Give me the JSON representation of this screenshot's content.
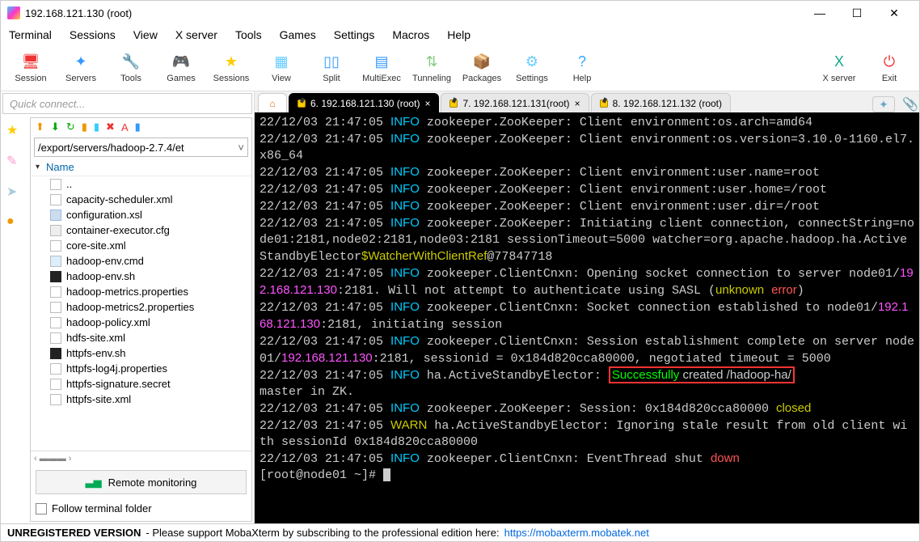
{
  "window": {
    "title": "192.168.121.130 (root)"
  },
  "menu": [
    "Terminal",
    "Sessions",
    "View",
    "X server",
    "Tools",
    "Games",
    "Settings",
    "Macros",
    "Help"
  ],
  "toolbar": [
    {
      "name": "session-button",
      "label": "Session",
      "glyph": "🖥",
      "color": "#e33"
    },
    {
      "name": "servers-button",
      "label": "Servers",
      "glyph": "✦",
      "color": "#39f"
    },
    {
      "name": "tools-button",
      "label": "Tools",
      "glyph": "🔧",
      "color": "#e80"
    },
    {
      "name": "games-button",
      "label": "Games",
      "glyph": "🎮",
      "color": "#9c3"
    },
    {
      "name": "sessions-button",
      "label": "Sessions",
      "glyph": "★",
      "color": "#fc0"
    },
    {
      "name": "view-button",
      "label": "View",
      "glyph": "▦",
      "color": "#6cf"
    },
    {
      "name": "split-button",
      "label": "Split",
      "glyph": "▯▯",
      "color": "#39f"
    },
    {
      "name": "multiexec-button",
      "label": "MultiExec",
      "glyph": "▤",
      "color": "#39f"
    },
    {
      "name": "tunneling-button",
      "label": "Tunneling",
      "glyph": "⇅",
      "color": "#8c8"
    },
    {
      "name": "packages-button",
      "label": "Packages",
      "glyph": "📦",
      "color": "#c96"
    },
    {
      "name": "settings-button",
      "label": "Settings",
      "glyph": "⚙",
      "color": "#6cf"
    },
    {
      "name": "help-button",
      "label": "Help",
      "glyph": "?",
      "color": "#3af"
    }
  ],
  "toolbar_right": [
    {
      "name": "xserver-button",
      "label": "X server",
      "glyph": "X",
      "color": "#1a8"
    },
    {
      "name": "exit-button",
      "label": "Exit",
      "glyph": "⏻",
      "color": "#e33"
    }
  ],
  "quick_connect_placeholder": "Quick connect...",
  "path": "/export/servers/hadoop-2.7.4/et",
  "file_header": "Name",
  "files": [
    {
      "label": "..",
      "icon": "dir"
    },
    {
      "label": "capacity-scheduler.xml",
      "icon": "xml"
    },
    {
      "label": "configuration.xsl",
      "icon": "xsl"
    },
    {
      "label": "container-executor.cfg",
      "icon": "cfg"
    },
    {
      "label": "core-site.xml",
      "icon": "xml"
    },
    {
      "label": "hadoop-env.cmd",
      "icon": "cmd"
    },
    {
      "label": "hadoop-env.sh",
      "icon": "sh"
    },
    {
      "label": "hadoop-metrics.properties",
      "icon": "xml"
    },
    {
      "label": "hadoop-metrics2.properties",
      "icon": "xml"
    },
    {
      "label": "hadoop-policy.xml",
      "icon": "xml"
    },
    {
      "label": "hdfs-site.xml",
      "icon": "xml"
    },
    {
      "label": "httpfs-env.sh",
      "icon": "sh"
    },
    {
      "label": "httpfs-log4j.properties",
      "icon": "xml"
    },
    {
      "label": "httpfs-signature.secret",
      "icon": "xml"
    },
    {
      "label": "httpfs-site.xml",
      "icon": "xml"
    }
  ],
  "remote_monitoring": "Remote monitoring",
  "follow_terminal": "Follow terminal folder",
  "tabs": [
    {
      "name": "tab-6",
      "label": "6. 192.168.121.130 (root)",
      "active": true,
      "close": true
    },
    {
      "name": "tab-7",
      "label": "7. 192.168.121.131(root)",
      "active": false,
      "close": true
    },
    {
      "name": "tab-8",
      "label": "8. 192.168.121.132 (root)",
      "active": false,
      "close": false
    }
  ],
  "terminal": {
    "lines": [
      [
        [
          "",
          "22/12/03 21:47:05 "
        ],
        [
          "info",
          "INFO"
        ],
        [
          "",
          " zookeeper.ZooKeeper: Client environment:os.arch=amd64"
        ]
      ],
      [
        [
          "",
          "22/12/03 21:47:05 "
        ],
        [
          "info",
          "INFO"
        ],
        [
          "",
          " zookeeper.ZooKeeper: Client environment:os.version=3.10.0-1160.el7.x86_64"
        ]
      ],
      [
        [
          "",
          "22/12/03 21:47:05 "
        ],
        [
          "info",
          "INFO"
        ],
        [
          "",
          " zookeeper.ZooKeeper: Client environment:user.name=root"
        ]
      ],
      [
        [
          "",
          "22/12/03 21:47:05 "
        ],
        [
          "info",
          "INFO"
        ],
        [
          "",
          " zookeeper.ZooKeeper: Client environment:user.home=/root"
        ]
      ],
      [
        [
          "",
          "22/12/03 21:47:05 "
        ],
        [
          "info",
          "INFO"
        ],
        [
          "",
          " zookeeper.ZooKeeper: Client environment:user.dir=/root"
        ]
      ],
      [
        [
          "",
          "22/12/03 21:47:05 "
        ],
        [
          "info",
          "INFO"
        ],
        [
          "",
          " zookeeper.ZooKeeper: Initiating client connection, connectString=node01:2181,node02:2181,node03:2181 sessionTimeout=5000 watcher=org.apache.hadoop.ha.ActiveStandbyElector"
        ],
        [
          "yel",
          "$WatcherWithClientRef"
        ],
        [
          "",
          "@77847718"
        ]
      ],
      [
        [
          "",
          "22/12/03 21:47:05 "
        ],
        [
          "info",
          "INFO"
        ],
        [
          "",
          " zookeeper.ClientCnxn: Opening socket connection to server node01/"
        ],
        [
          "mag",
          "192.168.121.130"
        ],
        [
          "",
          ":2181. Will not attempt to authenticate using SASL ("
        ],
        [
          "yel",
          "unknown"
        ],
        [
          "",
          " "
        ],
        [
          "red",
          "error"
        ],
        [
          "",
          ")"
        ]
      ],
      [
        [
          "",
          "22/12/03 21:47:05 "
        ],
        [
          "info",
          "INFO"
        ],
        [
          "",
          " zookeeper.ClientCnxn: Socket connection established to node01/"
        ],
        [
          "mag",
          "192.168.121.130"
        ],
        [
          "",
          ":2181, initiating session"
        ]
      ],
      [
        [
          "",
          "22/12/03 21:47:05 "
        ],
        [
          "info",
          "INFO"
        ],
        [
          "",
          " zookeeper.ClientCnxn: Session establishment complete on server node01/"
        ],
        [
          "mag",
          "192.168.121.130"
        ],
        [
          "",
          ":2181, sessionid = 0x184d820cca80000, negotiated timeout = 5000"
        ]
      ],
      [
        [
          "",
          "22/12/03 21:47:05 "
        ],
        [
          "info",
          "INFO"
        ],
        [
          "",
          " ha.ActiveStandbyElector: "
        ],
        [
          "boxed-grn",
          "Successfully"
        ],
        [
          "boxed",
          " created /hadoop-ha/"
        ]
      ],
      [
        [
          "",
          "master in ZK."
        ]
      ],
      [
        [
          "",
          "22/12/03 21:47:05 "
        ],
        [
          "info",
          "INFO"
        ],
        [
          "",
          " zookeeper.ZooKeeper: Session: 0x184d820cca80000 "
        ],
        [
          "yel",
          "closed"
        ]
      ],
      [
        [
          "",
          "22/12/03 21:47:05 "
        ],
        [
          "warn",
          "WARN"
        ],
        [
          "",
          " ha.ActiveStandbyElector: Ignoring stale result from old client with sessionId 0x184d820cca80000"
        ]
      ],
      [
        [
          "",
          "22/12/03 21:47:05 "
        ],
        [
          "info",
          "INFO"
        ],
        [
          "",
          " zookeeper.ClientCnxn: EventThread shut "
        ],
        [
          "red",
          "down"
        ]
      ]
    ],
    "prompt": "[root@node01 ~]# "
  },
  "footer": {
    "left": "UNREGISTERED VERSION",
    "mid": "-  Please support MobaXterm by subscribing to the professional edition here:",
    "link": "https://mobaxterm.mobatek.net"
  }
}
